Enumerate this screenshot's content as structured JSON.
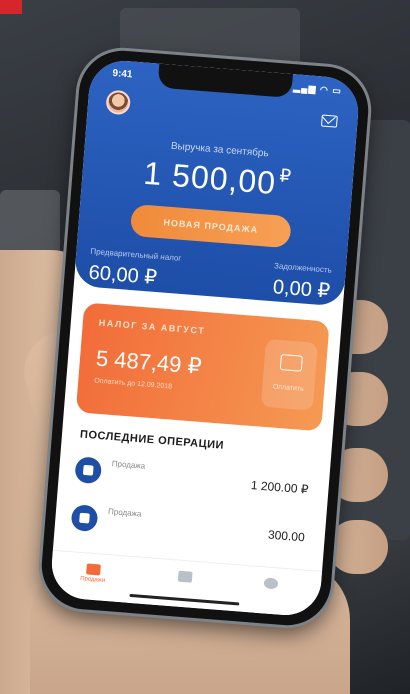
{
  "app": {
    "status_time": "9:41",
    "revenue_label": "Выручка за сентябрь",
    "revenue_amount": "1 500,00",
    "currency": "₽",
    "new_sale_label": "НОВАЯ ПРОДАЖА",
    "prepaid_tax_label": "Предварительный налог",
    "prepaid_tax_value": "60,00 ₽",
    "debt_label": "Задолженность",
    "debt_value": "0,00 ₽"
  },
  "tax_card": {
    "title": "НАЛОГ ЗА АВГУСТ",
    "amount": "5 487,49 ₽",
    "due": "Оплатить до 12.09.2018",
    "pay_label": "Оплатить"
  },
  "operations": {
    "title": "ПОСЛЕДНИЕ ОПЕРАЦИИ",
    "items": [
      {
        "name": "Продажа",
        "amount": "1 200.00 ₽"
      },
      {
        "name": "Продажа",
        "amount": "300.00"
      }
    ]
  },
  "tabbar": {
    "items": [
      {
        "label": "Продажи"
      },
      {
        "label": ""
      },
      {
        "label": ""
      }
    ]
  },
  "colors": {
    "header_blue": "#2d63c2",
    "accent_orange": "#f26b39"
  }
}
